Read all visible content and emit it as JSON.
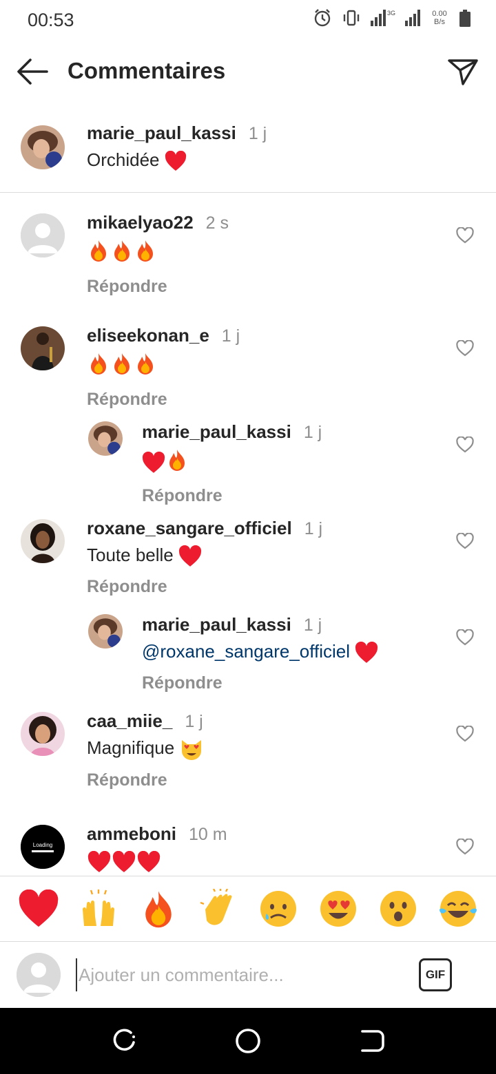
{
  "status_bar": {
    "time": "00:53",
    "net_tag": "3G",
    "net_speed_value": "0.00",
    "net_speed_unit": "B/s"
  },
  "header": {
    "title": "Commentaires",
    "back_icon": "arrow-left-icon",
    "share_icon": "send-icon"
  },
  "caption": {
    "username": "marie_paul_kassi",
    "time": "1 j",
    "text": "Orchidée",
    "emoji": "red-heart"
  },
  "comments": [
    {
      "username": "mikaelyao22",
      "time": "2 s",
      "text": "",
      "emojis": [
        "fire",
        "fire",
        "fire"
      ],
      "reply": "Répondre"
    },
    {
      "username": "eliseekonan_e",
      "time": "1 j",
      "text": "",
      "emojis": [
        "fire",
        "fire",
        "fire"
      ],
      "reply": "Répondre"
    },
    {
      "username": "marie_paul_kassi",
      "time": "1 j",
      "text": "",
      "emojis": [
        "red-heart",
        "fire"
      ],
      "reply": "Répondre"
    },
    {
      "username": "roxane_sangare_officiel",
      "time": "1 j",
      "text": "Toute belle",
      "emojis": [
        "red-heart"
      ],
      "reply": "Répondre"
    },
    {
      "username": "marie_paul_kassi",
      "time": "1 j",
      "mention": "@roxane_sangare_officiel",
      "emojis": [
        "red-heart"
      ],
      "reply": "Répondre"
    },
    {
      "username": "caa_miie_",
      "time": "1 j",
      "text": "Magnifique",
      "emojis": [
        "heart-eyes-cat"
      ],
      "reply": "Répondre"
    },
    {
      "username": "ammeboni",
      "time": "10 m",
      "text": "",
      "emojis": [
        "red-heart",
        "red-heart",
        "red-heart"
      ]
    }
  ],
  "avatar_text": "Loading",
  "emoji_bar": [
    "red-heart",
    "raising-hands",
    "fire",
    "clapping-hands",
    "sad-face",
    "heart-eyes",
    "surprised-face",
    "tears-of-joy"
  ],
  "composer": {
    "placeholder": "Ajouter un commentaire...",
    "gif_label": "GIF"
  },
  "colors": {
    "text": "#262626",
    "secondary": "#8e8e8e",
    "mention": "#00376b",
    "heart": "#ed1c2e",
    "divider": "#dbdbdb"
  }
}
